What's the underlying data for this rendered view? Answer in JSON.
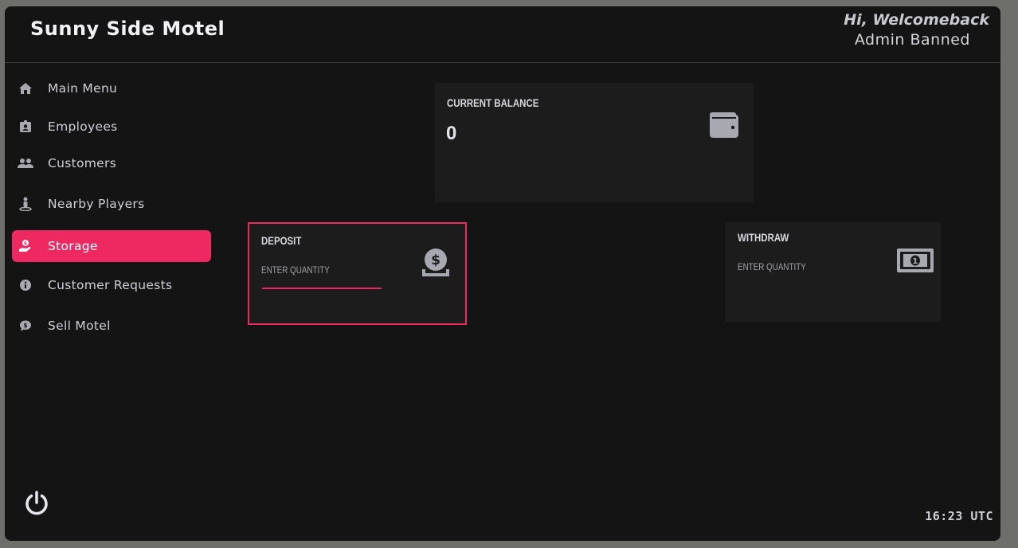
{
  "header": {
    "app_title": "Sunny Side Motel",
    "welcome": "Hi, Welcomeback",
    "username": "Admin Banned"
  },
  "sidebar": {
    "items": [
      {
        "label": "Main Menu",
        "icon": "home-icon"
      },
      {
        "label": "Employees",
        "icon": "id-badge-icon"
      },
      {
        "label": "Customers",
        "icon": "users-icon"
      },
      {
        "label": "Nearby Players",
        "icon": "person-icon"
      },
      {
        "label": "Storage",
        "icon": "hand-holding-dollar-icon",
        "active": true
      },
      {
        "label": "Customer Requests",
        "icon": "info-icon"
      },
      {
        "label": "Sell Motel",
        "icon": "comment-dollar-icon"
      }
    ]
  },
  "balance": {
    "title": "CURRENT BALANCE",
    "value": "0",
    "icon": "wallet-icon"
  },
  "deposit": {
    "title": "DEPOSIT",
    "placeholder": "ENTER QUANTITY",
    "icon": "coin-dollar-icon"
  },
  "withdraw": {
    "title": "WITHDRAW",
    "placeholder": "ENTER QUANTITY",
    "icon": "money-bill-icon"
  },
  "footer": {
    "clock": "16:23 UTC"
  },
  "colors": {
    "accent": "#ee2860",
    "background": "#141415",
    "card": "#1c1c1d",
    "icon": "#a8a8b0"
  }
}
